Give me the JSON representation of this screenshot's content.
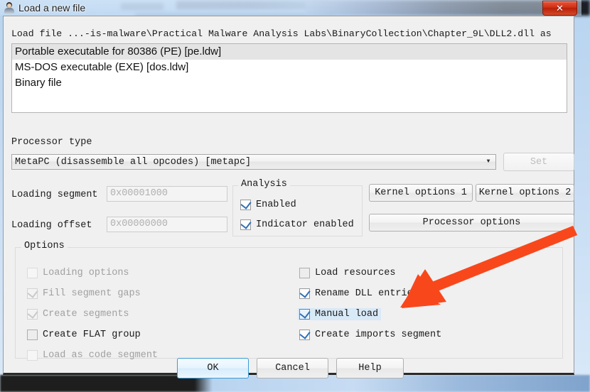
{
  "window": {
    "title": "Load a new file",
    "icon": "ida-person-icon",
    "close_label": "✕",
    "accent_blue": "#3c9bd4",
    "titlebar_bg": "#cfe2f6"
  },
  "dialog": {
    "file_path_label": "Load file ...-is-malware\\Practical Malware Analysis Labs\\BinaryCollection\\Chapter_9L\\DLL2.dll as",
    "loader_list": [
      {
        "label": "Portable executable for 80386 (PE) [pe.ldw]",
        "selected": true
      },
      {
        "label": "MS-DOS executable (EXE) [dos.ldw]",
        "selected": false
      },
      {
        "label": "Binary file",
        "selected": false
      }
    ],
    "processor": {
      "group_label": "Processor type",
      "selected_value": "MetaPC (disassemble all opcodes) [metapc]",
      "dropdown_icon": "chevron-down-icon",
      "set_button_label": "Set",
      "set_button_enabled": false
    },
    "loading": {
      "segment_label": "Loading segment",
      "segment_value": "0x00001000",
      "segment_enabled": false,
      "offset_label": "Loading offset",
      "offset_value": "0x00000000",
      "offset_enabled": false
    },
    "analysis": {
      "group_label": "Analysis",
      "items": [
        {
          "label": "Enabled",
          "checked": true,
          "enabled": true
        },
        {
          "label": "Indicator enabled",
          "checked": true,
          "enabled": true
        }
      ]
    },
    "side_buttons": {
      "kernel_options_1": "Kernel options 1",
      "kernel_options_2": "Kernel options 2",
      "processor_options": "Processor options"
    },
    "options": {
      "group_label": "Options",
      "left_column": [
        {
          "label": "Loading options",
          "checked": false,
          "enabled": false
        },
        {
          "label": "Fill segment gaps",
          "checked": true,
          "enabled": false
        },
        {
          "label": "Create segments",
          "checked": true,
          "enabled": false
        },
        {
          "label": "Create FLAT group",
          "checked": false,
          "enabled": true
        },
        {
          "label": "Load as code segment",
          "checked": false,
          "enabled": false
        }
      ],
      "right_column": [
        {
          "label": "Load resources",
          "checked": false,
          "enabled": true,
          "focused": false
        },
        {
          "label": "Rename DLL entries",
          "checked": true,
          "enabled": true,
          "focused": false
        },
        {
          "label": "Manual load",
          "checked": true,
          "enabled": true,
          "focused": true
        },
        {
          "label": "Create imports segment",
          "checked": true,
          "enabled": true,
          "focused": false
        }
      ]
    },
    "footer": {
      "ok_label": "OK",
      "cancel_label": "Cancel",
      "help_label": "Help",
      "default_button": "OK"
    }
  },
  "annotation": {
    "arrow_color": "#f9471c",
    "points_at": "Manual load"
  }
}
